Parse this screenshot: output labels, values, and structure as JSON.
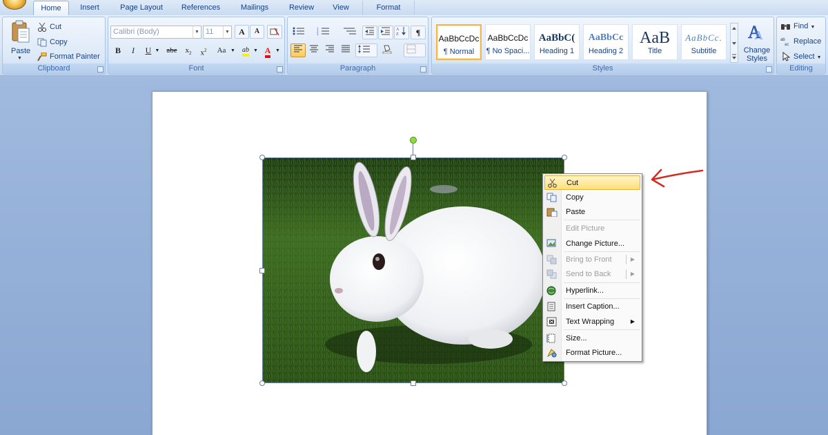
{
  "tabs": [
    {
      "label": "Home",
      "active": true
    },
    {
      "label": "Insert"
    },
    {
      "label": "Page Layout"
    },
    {
      "label": "References"
    },
    {
      "label": "Mailings"
    },
    {
      "label": "Review"
    },
    {
      "label": "View"
    },
    {
      "label": "Format",
      "contextual": true
    }
  ],
  "clipboard": {
    "group_label": "Clipboard",
    "paste": "Paste",
    "cut": "Cut",
    "copy": "Copy",
    "format_painter": "Format Painter"
  },
  "font": {
    "group_label": "Font",
    "font_name": "Calibri (Body)",
    "font_size": "11",
    "grow": "A",
    "shrink": "A",
    "bold": "B",
    "italic": "I",
    "underline": "U",
    "strike": "abe",
    "subscript": "x",
    "superscript": "x",
    "change_case": "Aa",
    "highlight": "ab",
    "font_color": "A"
  },
  "paragraph": {
    "group_label": "Paragraph",
    "show_marks": "¶"
  },
  "styles": {
    "group_label": "Styles",
    "items": [
      {
        "sample": "AaBbCcDc",
        "name": "¶ Normal",
        "selected": true
      },
      {
        "sample": "AaBbCcDc",
        "name": "¶ No Spaci..."
      },
      {
        "sample": "AaBbC(",
        "name": "Heading 1"
      },
      {
        "sample": "AaBbCc",
        "name": "Heading 2"
      },
      {
        "sample": "AaB",
        "name": "Title"
      },
      {
        "sample": "AaBbCc.",
        "name": "Subtitle"
      }
    ],
    "change_styles": "Change Styles"
  },
  "editing": {
    "group_label": "Editing",
    "find": "Find",
    "replace": "Replace",
    "select": "Select"
  },
  "context_menu": {
    "items": [
      {
        "label": "Cut",
        "icon": "scissors-icon",
        "state": "hover"
      },
      {
        "label": "Copy",
        "icon": "copy-icon"
      },
      {
        "label": "Paste",
        "icon": "paste-icon"
      },
      {
        "label": "Edit Picture",
        "icon": "",
        "state": "disabled"
      },
      {
        "label": "Change Picture...",
        "icon": "change-picture-icon"
      },
      {
        "label": "Bring to Front",
        "icon": "bring-front-icon",
        "state": "disabled",
        "submenu": true
      },
      {
        "label": "Send to Back",
        "icon": "send-back-icon",
        "state": "disabled",
        "submenu": true
      },
      {
        "label": "Hyperlink...",
        "icon": "hyperlink-icon"
      },
      {
        "label": "Insert Caption...",
        "icon": "caption-icon"
      },
      {
        "label": "Text Wrapping",
        "icon": "text-wrapping-icon",
        "submenu": true
      },
      {
        "label": "Size...",
        "icon": "size-icon"
      },
      {
        "label": "Format Picture...",
        "icon": "format-picture-icon"
      }
    ]
  },
  "annotation": {
    "arrow_color": "#d42a20",
    "points_to": "Cut"
  },
  "picture": {
    "subject": "white rabbit on grass"
  }
}
